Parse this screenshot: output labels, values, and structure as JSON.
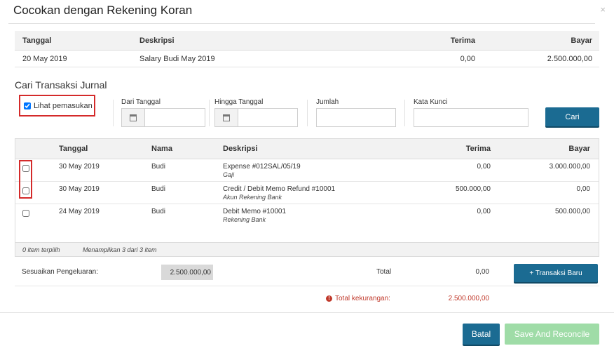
{
  "modal": {
    "title": "Cocokan dengan Rekening Koran",
    "close_label": "×"
  },
  "bank": {
    "headers": {
      "tanggal": "Tanggal",
      "deskripsi": "Deskripsi",
      "terima": "Terima",
      "bayar": "Bayar"
    },
    "row": {
      "tanggal": "20 May 2019",
      "deskripsi": "Salary Budi May 2019",
      "terima": "0,00",
      "bayar": "2.500.000,00"
    }
  },
  "search": {
    "section_title": "Cari Transaksi Jurnal",
    "lihat_label": "Lihat pemasukan",
    "lihat_checked": true,
    "dari_label": "Dari Tanggal",
    "hingga_label": "Hingga Tanggal",
    "jumlah_label": "Jumlah",
    "kata_label": "Kata Kunci",
    "cari_label": "Cari"
  },
  "journal": {
    "headers": {
      "tanggal": "Tanggal",
      "nama": "Nama",
      "deskripsi": "Deskripsi",
      "terima": "Terima",
      "bayar": "Bayar"
    },
    "rows": [
      {
        "tanggal": "30 May 2019",
        "nama": "Budi",
        "deskripsi": "Expense #012SAL/05/19",
        "sub": "Gaji",
        "terima": "0,00",
        "bayar": "3.000.000,00"
      },
      {
        "tanggal": "30 May 2019",
        "nama": "Budi",
        "deskripsi": "Credit / Debit Memo Refund #10001",
        "sub": "Akun Rekening Bank",
        "terima": "500.000,00",
        "bayar": "0,00"
      },
      {
        "tanggal": "24 May 2019",
        "nama": "Budi",
        "deskripsi": "Debit Memo #10001",
        "sub": "Rekening Bank",
        "terima": "0,00",
        "bayar": "500.000,00"
      }
    ],
    "footer": {
      "selected": "0 item terpilih",
      "showing": "Menampilkan 3 dari 3 item"
    }
  },
  "adjust": {
    "label": "Sesuaikan Pengeluaran:",
    "value": "2.500.000,00",
    "total_label": "Total",
    "total_value": "0,00",
    "new_tx_label": "+ Transaksi Baru"
  },
  "shortfall": {
    "label": "Total kekurangan:",
    "value": "2.500.000,00"
  },
  "actions": {
    "batal_label": "Batal",
    "save_label": "Save And Reconcile"
  }
}
